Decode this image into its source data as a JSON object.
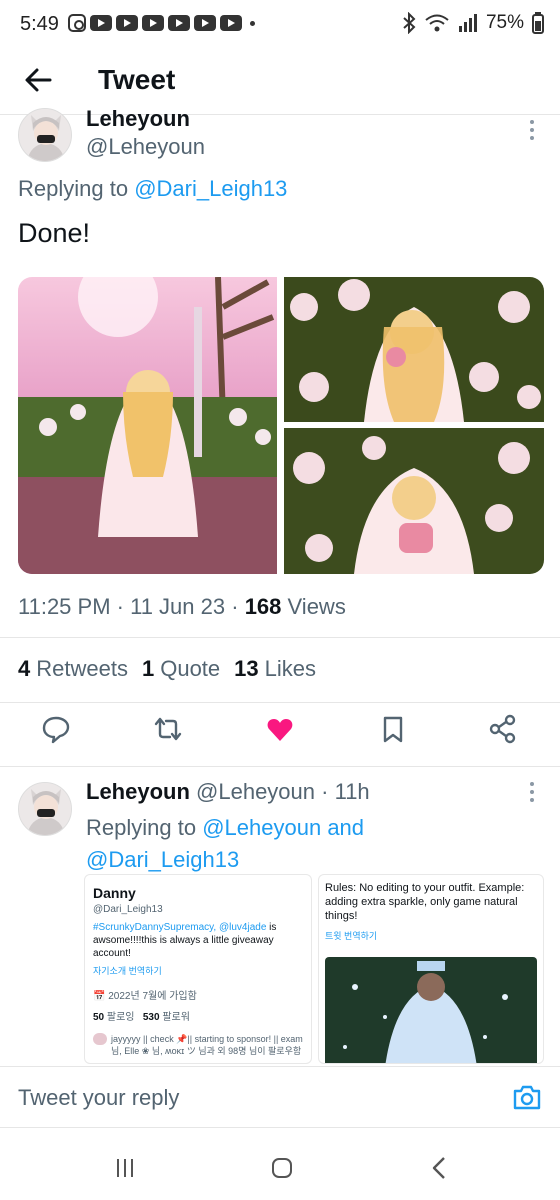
{
  "status_bar": {
    "time": "5:49",
    "battery": "75%"
  },
  "header": {
    "title": "Tweet"
  },
  "tweet": {
    "author_name": "Leheyoun",
    "author_handle": "@Leheyoun",
    "replying_prefix": "Replying to",
    "replying_to": "@Dari_Leigh13",
    "text": "Done!",
    "time": "11:25 PM",
    "date": "11 Jun 23",
    "views_count": "168",
    "views_label": "Views",
    "retweets_count": "4",
    "retweets_label": "Retweets",
    "quotes_count": "1",
    "quotes_label": "Quote",
    "likes_count": "13",
    "likes_label": "Likes",
    "liked": true
  },
  "reply": {
    "author_name": "Leheyoun",
    "author_handle": "@Leheyoun",
    "age": "11h",
    "replying_prefix": "Replying to",
    "replying_to_1": "@Leheyoun",
    "replying_and": "and",
    "replying_to_2": "@Dari_Leigh13",
    "card_left": {
      "name": "Danny",
      "handle": "@Dari_Leigh13",
      "bio_tags": "#ScrunkyDannySupremacy, @luv4jade",
      "bio_text": "is awsome!!!!this is always a little giveaway account!",
      "translate": "자기소개 번역하기",
      "joined": "2022년 7월에 가입함",
      "following_count": "50",
      "following_label": "팔로잉",
      "followers_count": "530",
      "followers_label": "팔로워",
      "followers_note": "jayyyyy || check 📌|| starting to sponsor! || exam 님, Elle ❀ 님, ʍᴏᴋɪ ツ 님과 외 98명 님이 팔로우함"
    },
    "card_right": {
      "rules": "Rules: No editing to your outfit. Example: adding extra sparkle, only game natural things!",
      "translate": "트윗 번역하기"
    }
  },
  "reply_bar": {
    "placeholder": "Tweet your reply"
  },
  "colors": {
    "accent": "#1d9bf0",
    "like": "#f91880",
    "text": "#0f1419",
    "secondary": "#536471"
  }
}
